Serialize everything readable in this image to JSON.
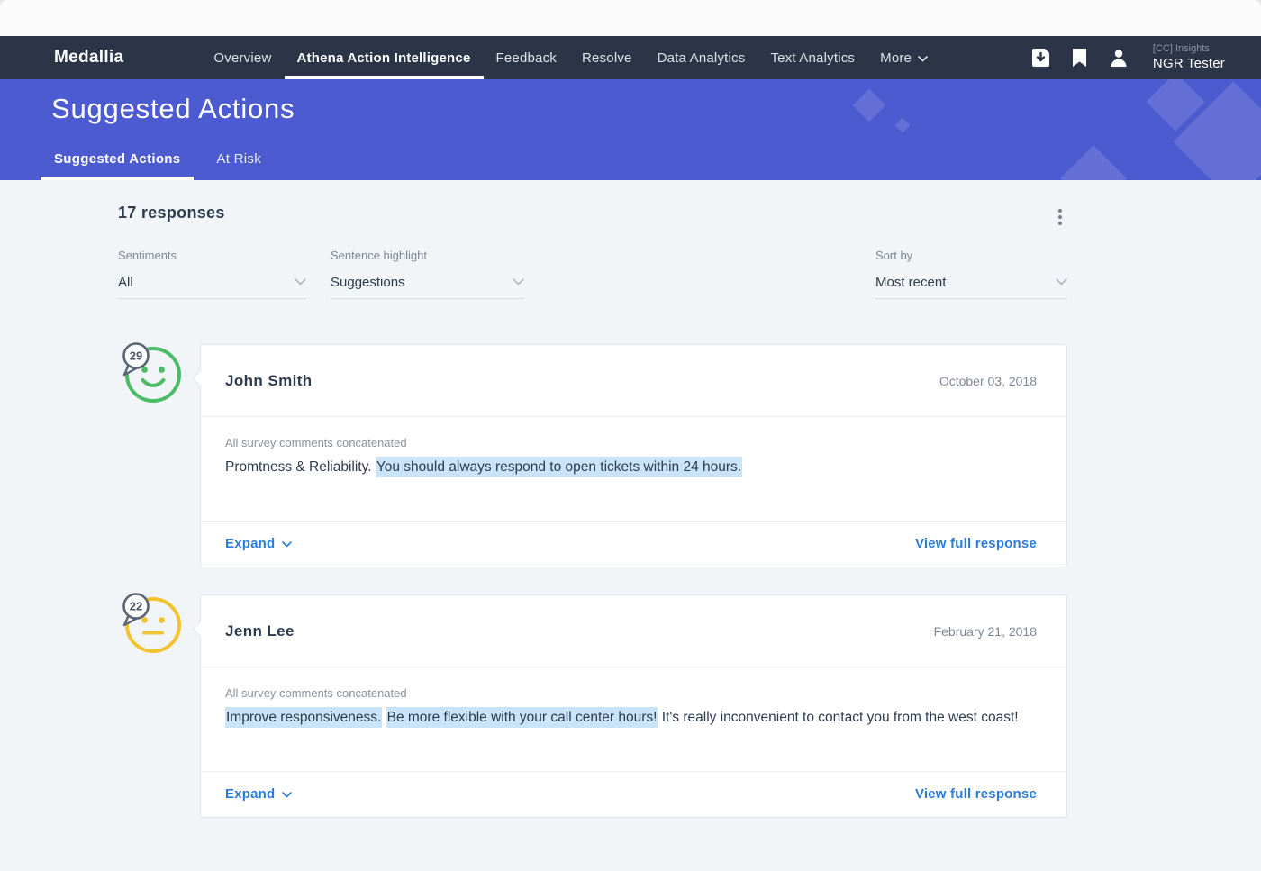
{
  "nav": {
    "brand": "Medallia",
    "items": [
      {
        "label": "Overview",
        "active": false
      },
      {
        "label": "Athena Action Intelligence",
        "active": true
      },
      {
        "label": "Feedback",
        "active": false
      },
      {
        "label": "Resolve",
        "active": false
      },
      {
        "label": "Data Analytics",
        "active": false
      },
      {
        "label": "Text Analytics",
        "active": false
      },
      {
        "label": "More",
        "active": false,
        "icon": "chevron-down-icon"
      }
    ],
    "icons": [
      "export-download-icon",
      "bookmark-icon",
      "user-icon"
    ],
    "user": {
      "org": "[CC] Insights",
      "name": "NGR Tester"
    }
  },
  "header": {
    "title": "Suggested Actions",
    "tabs": [
      {
        "label": "Suggested Actions",
        "active": true
      },
      {
        "label": "At Risk",
        "active": false
      }
    ]
  },
  "toolbar": {
    "count": "17 responses",
    "menu_icon": "kebab-menu-icon",
    "filters": [
      {
        "label": "Sentiments",
        "value": "All"
      },
      {
        "label": "Sentence highlight",
        "value": "Suggestions"
      }
    ],
    "sort": {
      "label": "Sort by",
      "value": "Most recent"
    }
  },
  "responses": [
    {
      "score": "29",
      "sentiment": "positive",
      "name": "John Smith",
      "date": "October 03, 2018",
      "comment_label": "All survey comments concatenated",
      "segments": [
        {
          "text": "Promtness & Reliability. ",
          "highlight": false
        },
        {
          "text": "You should always respond to open tickets within 24 hours.",
          "highlight": true
        }
      ],
      "expand_label": "Expand",
      "view_label": "View full response"
    },
    {
      "score": "22",
      "sentiment": "neutral",
      "name": "Jenn Lee",
      "date": "February 21, 2018",
      "comment_label": "All survey comments concatenated",
      "segments": [
        {
          "text": "Improve responsiveness.",
          "highlight": true
        },
        {
          "text": " ",
          "highlight": false
        },
        {
          "text": "Be more flexible with your call center hours!",
          "highlight": true
        },
        {
          "text": " It's really inconvenient to contact you from the west coast!",
          "highlight": false
        }
      ],
      "expand_label": "Expand",
      "view_label": "View full response"
    }
  ],
  "colors": {
    "nav_background": "#2b3547",
    "header_background": "#4d5bd0",
    "content_background": "#f2f5f7",
    "link_blue": "#2b7cd9",
    "highlight_blue": "#c9e4f9",
    "sentiment_positive": "#4cbb68",
    "sentiment_neutral": "#f1c330",
    "text_dark": "#2d3b4d",
    "text_gray": "#7e8894"
  }
}
